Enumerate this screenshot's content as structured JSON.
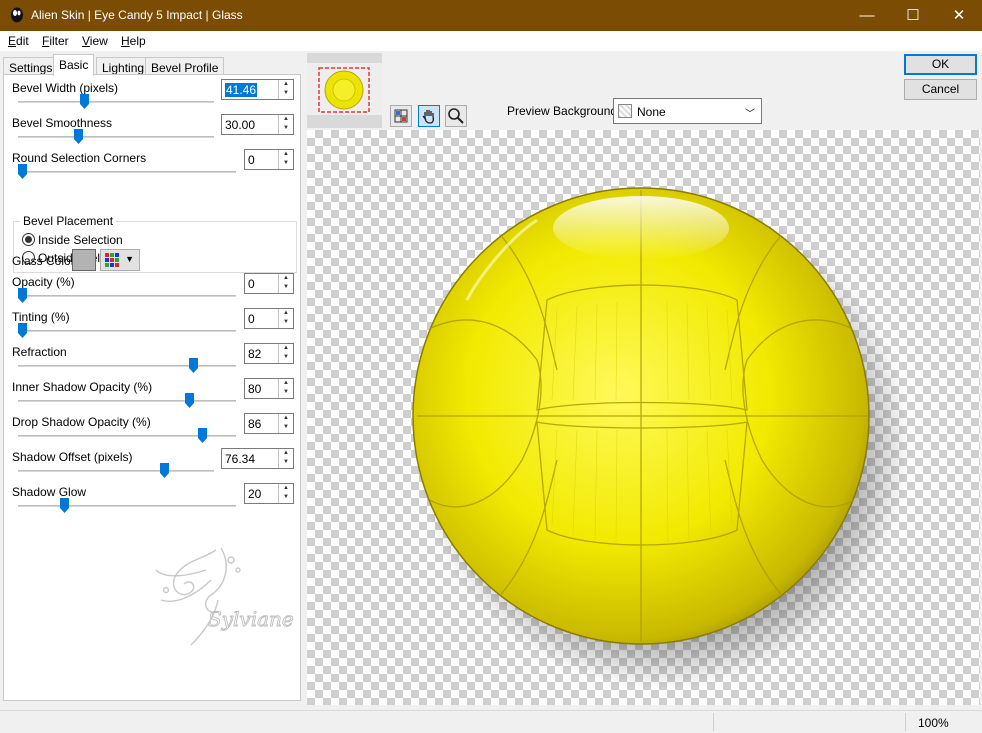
{
  "window": {
    "title": "Alien Skin | Eye Candy 5 Impact | Glass",
    "minimize_glyph": "—",
    "maximize_glyph": "☐",
    "close_glyph": "✕"
  },
  "menu": [
    {
      "underline": "E",
      "rest": "dit"
    },
    {
      "underline": "F",
      "rest": "ilter"
    },
    {
      "underline": "V",
      "rest": "iew"
    },
    {
      "underline": "H",
      "rest": "elp"
    }
  ],
  "tabs": [
    "Settings",
    "Basic",
    "Lighting",
    "Bevel Profile"
  ],
  "active_tab": "Basic",
  "controls": {
    "bevel_width": {
      "label": "Bevel Width (pixels)",
      "value": "41.46",
      "level": 0.33
    },
    "bevel_smoothness": {
      "label": "Bevel Smoothness",
      "value": "30.00",
      "level": 0.3
    },
    "round_corners": {
      "label": "Round Selection Corners",
      "value": "0",
      "level": 0.0
    },
    "bevel_placement": {
      "legend": "Bevel Placement",
      "options": [
        "Inside Selection",
        "Outside Selection"
      ],
      "selected": "Inside Selection"
    },
    "glass_color": {
      "label": "Glass Color",
      "color": "#b3b3b3"
    },
    "opacity": {
      "label": "Opacity (%)",
      "value": "0",
      "level": 0.0
    },
    "tinting": {
      "label": "Tinting (%)",
      "value": "0",
      "level": 0.0
    },
    "refraction": {
      "label": "Refraction",
      "value": "82",
      "level": 0.82
    },
    "inner_shadow_opacity": {
      "label": "Inner Shadow Opacity (%)",
      "value": "80",
      "level": 0.8
    },
    "drop_shadow_opacity": {
      "label": "Drop Shadow Opacity (%)",
      "value": "86",
      "level": 0.86
    },
    "shadow_offset": {
      "label": "Shadow Offset (pixels)",
      "value": "76.34",
      "level": 0.76
    },
    "shadow_glow": {
      "label": "Shadow Glow",
      "value": "20",
      "level": 0.2
    }
  },
  "watermark_text": "Sylviane",
  "buttons": {
    "ok": "OK",
    "cancel": "Cancel"
  },
  "preview_background": {
    "label": "Preview Background:",
    "value": "None"
  },
  "status": {
    "zoom": "100%"
  },
  "colors": {
    "titlebar": "#7a4c04",
    "accent": "#0078d7",
    "glass": "#f2ec00"
  }
}
